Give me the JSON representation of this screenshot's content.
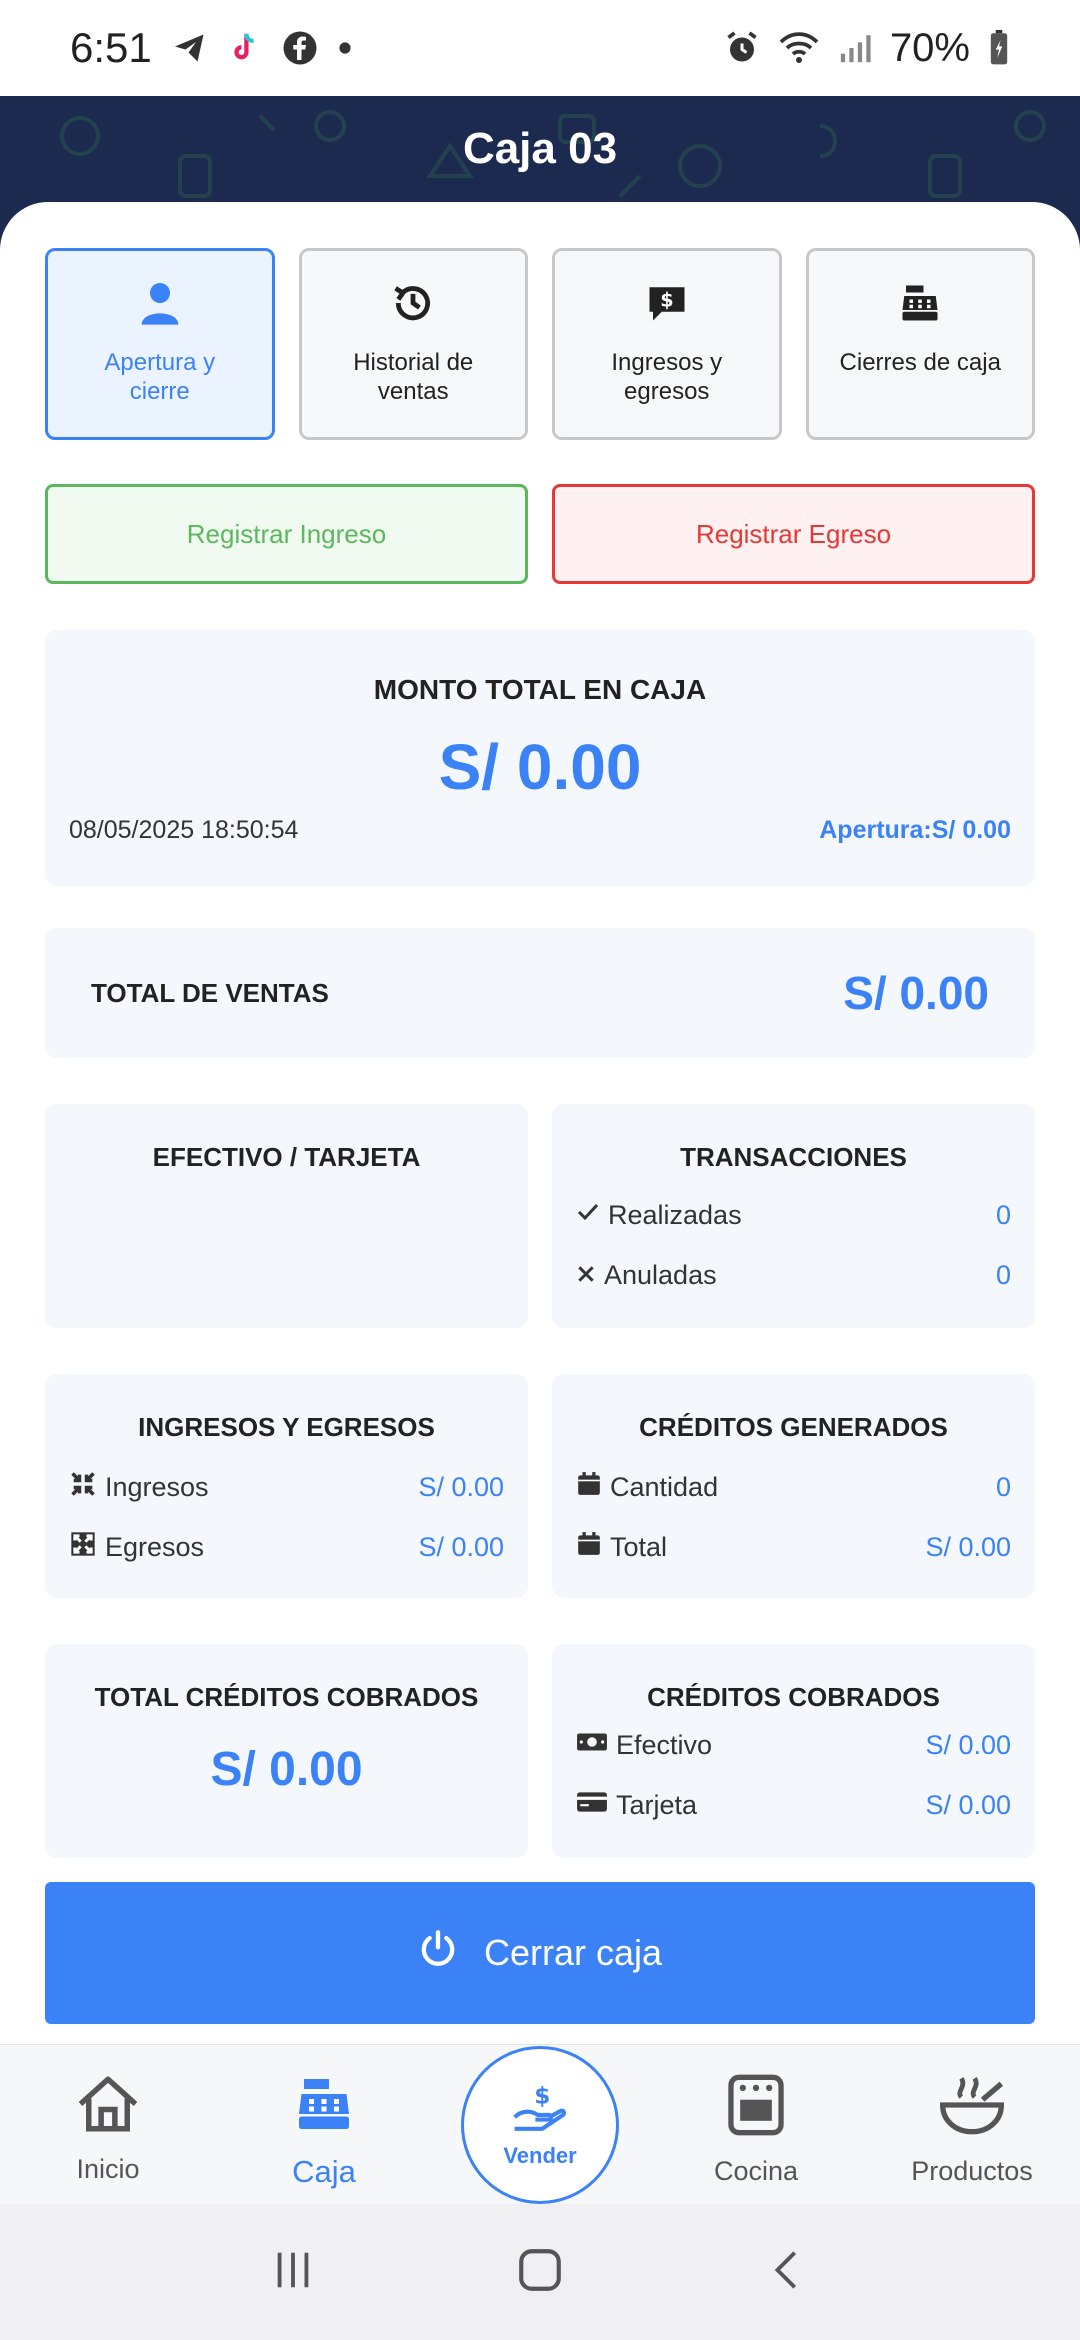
{
  "status_bar": {
    "time": "6:51",
    "battery": "70%"
  },
  "header": {
    "title": "Caja 03"
  },
  "tiles": [
    {
      "label": "Apertura y cierre",
      "icon": "user-icon",
      "active": true
    },
    {
      "label": "Historial de ventas",
      "icon": "history-icon",
      "active": false
    },
    {
      "label": "Ingresos y egresos",
      "icon": "dollar-chat-icon",
      "active": false
    },
    {
      "label": "Cierres de caja",
      "icon": "cash-register-icon",
      "active": false
    }
  ],
  "actions": {
    "ingreso": "Registrar Ingreso",
    "egreso": "Registrar Egreso"
  },
  "monto": {
    "title": "MONTO TOTAL EN CAJA",
    "value": "S/ 0.00",
    "datetime": "08/05/2025 18:50:54",
    "apertura": "Apertura:S/ 0.00"
  },
  "ventas": {
    "label": "TOTAL DE VENTAS",
    "value": "S/ 0.00"
  },
  "efectivo_tarjeta": {
    "title": "EFECTIVO / TARJETA"
  },
  "transacciones": {
    "title": "TRANSACCIONES",
    "realizadas_label": "Realizadas",
    "realizadas_value": "0",
    "anuladas_label": "Anuladas",
    "anuladas_value": "0"
  },
  "ingresos_egresos": {
    "title": "INGRESOS Y EGRESOS",
    "ingresos_label": "Ingresos",
    "ingresos_value": "S/ 0.00",
    "egresos_label": "Egresos",
    "egresos_value": "S/ 0.00"
  },
  "creditos_generados": {
    "title": "CRÉDITOS GENERADOS",
    "cantidad_label": "Cantidad",
    "cantidad_value": "0",
    "total_label": "Total",
    "total_value": "S/ 0.00"
  },
  "total_creditos_cobrados": {
    "title": "TOTAL CRÉDITOS COBRADOS",
    "value": "S/ 0.00"
  },
  "creditos_cobrados": {
    "title": "CRÉDITOS COBRADOS",
    "efectivo_label": "Efectivo",
    "efectivo_value": "S/ 0.00",
    "tarjeta_label": "Tarjeta",
    "tarjeta_value": "S/ 0.00"
  },
  "cerrar_caja": "Cerrar caja",
  "nav": {
    "inicio": "Inicio",
    "caja": "Caja",
    "vender": "Vender",
    "cocina": "Cocina",
    "productos": "Productos"
  },
  "colors": {
    "accent": "#3b82f6",
    "header_bg": "#1b2a4e",
    "green": "#5cb85c",
    "red": "#e53935"
  }
}
